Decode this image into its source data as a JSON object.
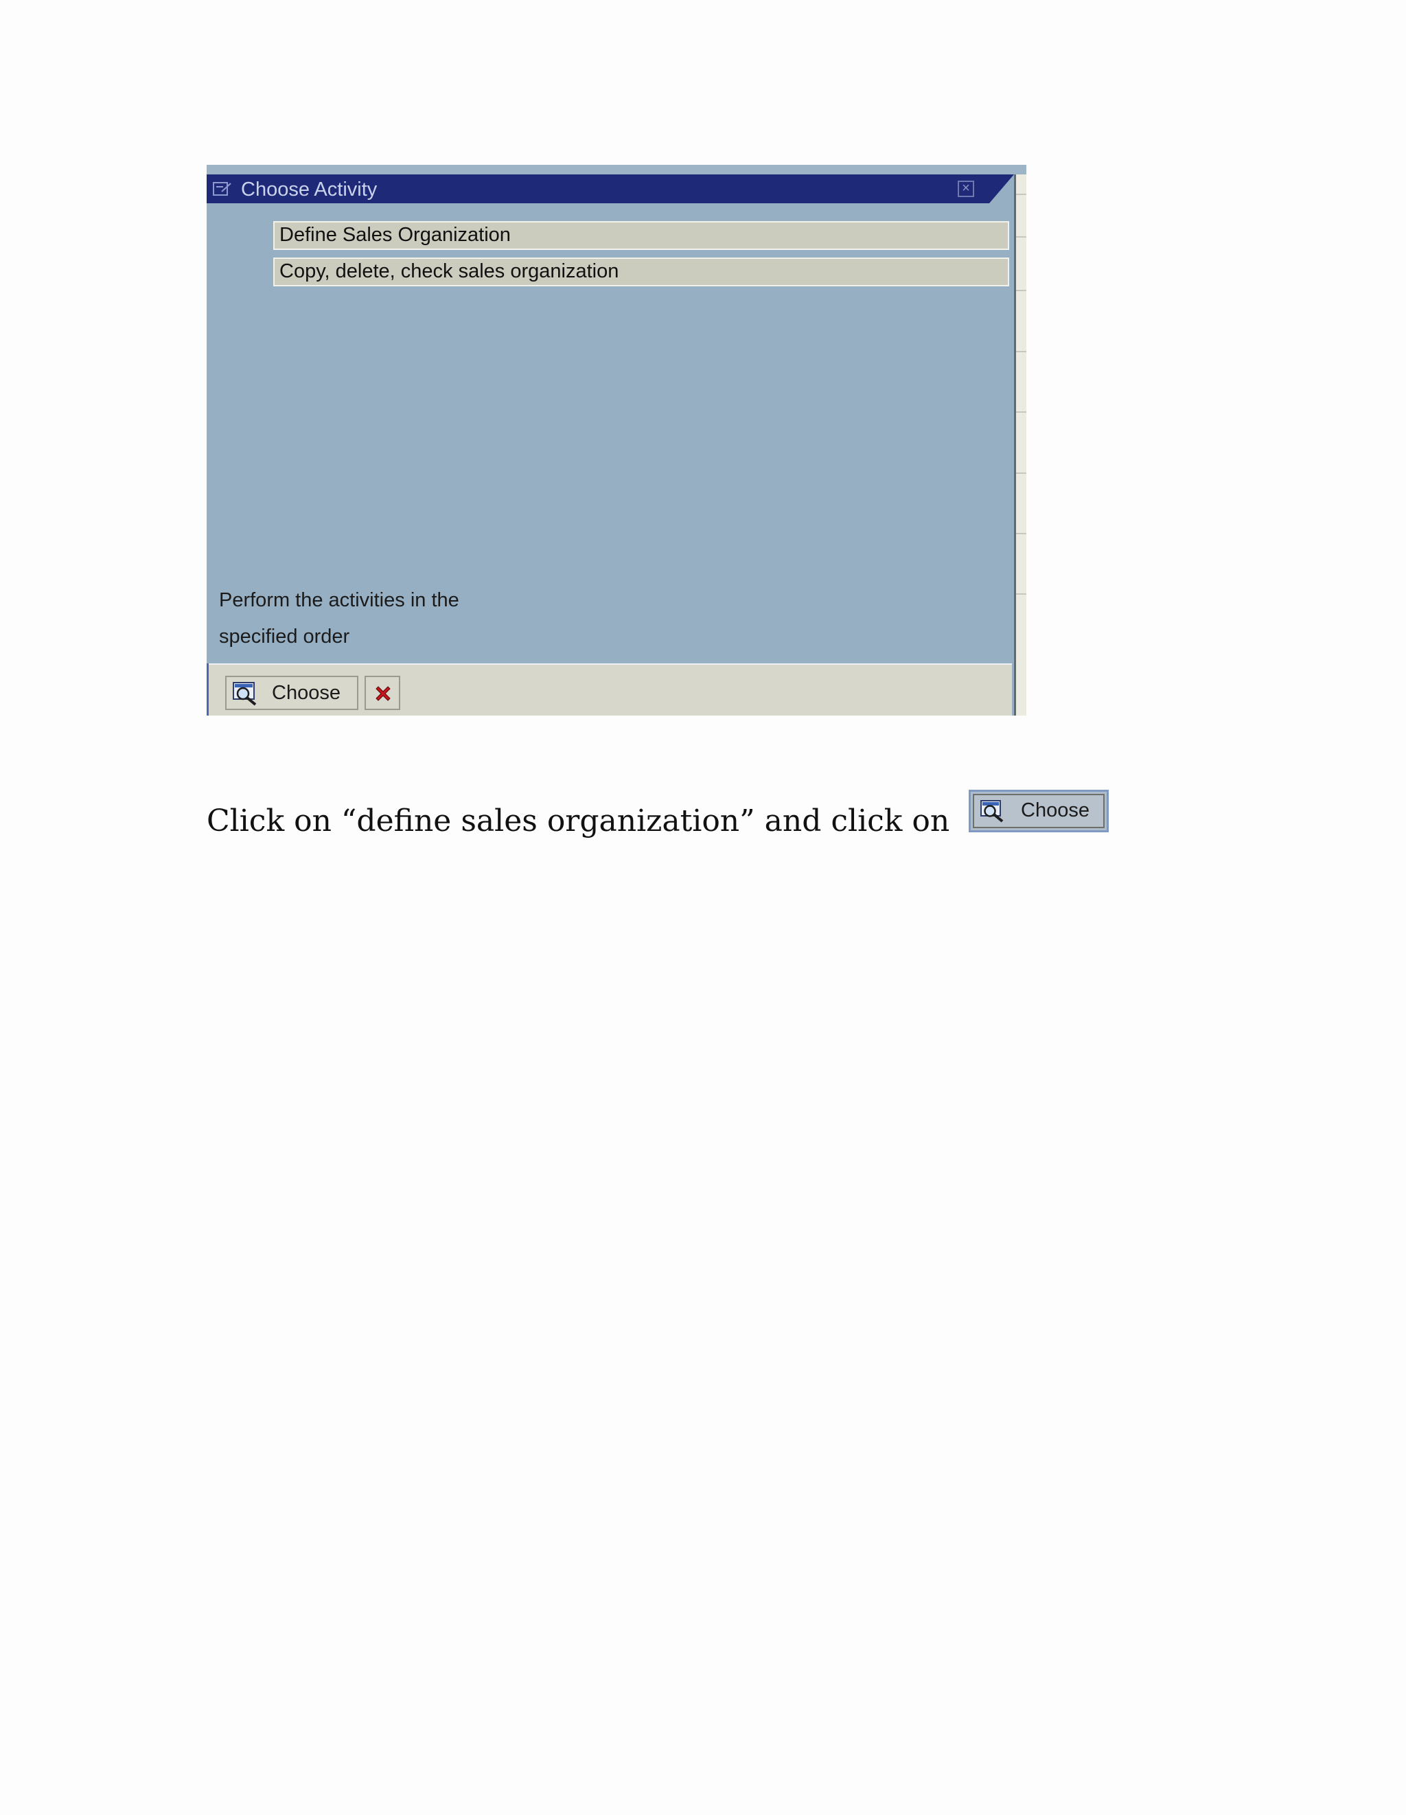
{
  "dialog": {
    "title": "Choose Activity",
    "title_icon": "activity-icon",
    "close_icon": "close-icon",
    "activities": [
      {
        "label": "Define Sales Organization"
      },
      {
        "label": "Copy, delete, check sales organization"
      }
    ],
    "hint_lines": [
      "Perform the activities in the",
      "specified order"
    ],
    "toolbar": {
      "choose_label": "Choose",
      "choose_icon": "magnifier-choose-icon",
      "cancel_icon": "red-x-cancel-icon"
    },
    "colors": {
      "titlebar": "#1e2a78",
      "body": "#97afc2",
      "item": "#cbcbbe",
      "toolbar": "#d7d7cb",
      "cancel": "#c4161c"
    }
  },
  "instruction": {
    "text": "Click on “define sales organization” and click on",
    "button_label": "Choose",
    "button_icon": "magnifier-choose-icon"
  }
}
